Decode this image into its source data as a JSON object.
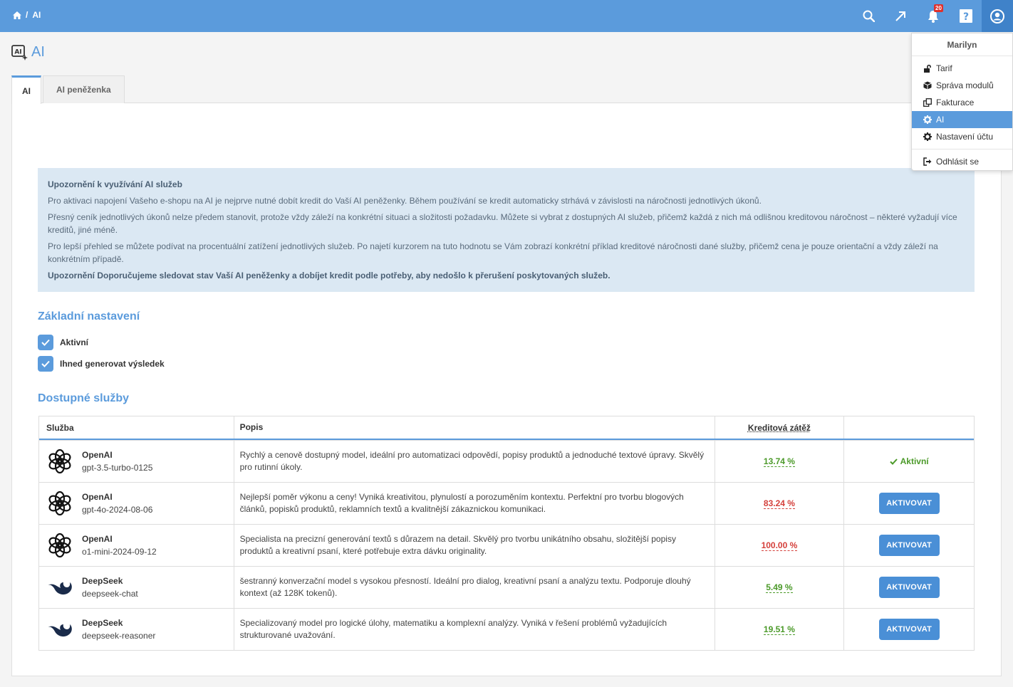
{
  "breadcrumb": {
    "current": "AI"
  },
  "topbar": {
    "notification_count": "20"
  },
  "page": {
    "title": "AI"
  },
  "tabs": [
    {
      "label": "AI"
    },
    {
      "label": "AI peněženka"
    }
  ],
  "alert": {
    "heading": "Upozornění k využívání AI služeb",
    "p1": "Pro aktivaci napojení Vašeho e-shopu na AI je nejprve nutné dobít kredit do Vaší AI peněženky. Během používání se kredit automaticky strhává v závislosti na náročnosti jednotlivých úkonů.",
    "p2": "Přesný ceník jednotlivých úkonů nelze předem stanovit, protože vždy záleží na konkrétní situaci a složitosti požadavku. Můžete si vybrat z dostupných AI služeb, přičemž každá z nich má odlišnou kreditovou náročnost – některé vyžadují více kreditů, jiné méně.",
    "p3": "Pro lepší přehled se můžete podívat na procentuální zatížení jednotlivých služeb. Po najetí kurzorem na tuto hodnotu se Vám zobrazí konkrétní příklad kreditové náročnosti dané služby, přičemž cena je pouze orientační a vždy záleží na konkrétním případě.",
    "warning": "Upozornění Doporučujeme sledovat stav Vaší AI peněženky a dobíjet kredit podle potřeby, aby nedošlo k přerušení poskytovaných služeb."
  },
  "settings": {
    "title": "Základní nastavení",
    "active_label": "Aktivní",
    "generate_label": "Ihned generovat výsledek"
  },
  "services": {
    "title": "Dostupné služby",
    "columns": {
      "service": "Služba",
      "desc": "Popis",
      "load": "Kreditová zátěž"
    },
    "rows": [
      {
        "provider": "OpenAI",
        "model": "gpt-3.5-turbo-0125",
        "desc": "Rychlý a cenově dostupný model, ideální pro automatizaci odpovědí, popisy produktů a jednoduché textové úpravy. Skvělý pro rutinní úkoly.",
        "load": "13.74 %",
        "status": "Aktivní"
      },
      {
        "provider": "OpenAI",
        "model": "gpt-4o-2024-08-06",
        "desc": "Nejlepší poměr výkonu a ceny! Vyniká kreativitou, plynulostí a porozuměním kontextu. Perfektní pro tvorbu blogových článků, popisků produktů, reklamních textů a kvalitnější zákaznickou komunikaci.",
        "load": "83.24 %",
        "button": "AKTIVOVAT"
      },
      {
        "provider": "OpenAI",
        "model": "o1-mini-2024-09-12",
        "desc": "Specialista na precizní generování textů s důrazem na detail. Skvělý pro tvorbu unikátního obsahu, složitější popisy produktů a kreativní psaní, které potřebuje extra dávku originality.",
        "load": "100.00 %",
        "button": "AKTIVOVAT"
      },
      {
        "provider": "DeepSeek",
        "model": "deepseek-chat",
        "desc": "šestranný konverzační model s vysokou přesností. Ideální pro dialog, kreativní psaní a analýzu textu. Podporuje dlouhý kontext (až 128K tokenů).",
        "load": "5.49 %",
        "button": "AKTIVOVAT"
      },
      {
        "provider": "DeepSeek",
        "model": "deepseek-reasoner",
        "desc": "Specializovaný model pro logické úlohy, matematiku a komplexní analýzy. Vyniká v řešení problémů vyžadujících strukturované uvažování.",
        "load": "19.51 %",
        "button": "AKTIVOVAT"
      }
    ]
  },
  "user_menu": {
    "user": "Marilyn",
    "items": [
      {
        "label": "Tarif",
        "icon": "unlock-icon"
      },
      {
        "label": "Správa modulů",
        "icon": "cube-icon"
      },
      {
        "label": "Fakturace",
        "icon": "copy-icon"
      },
      {
        "label": "AI",
        "icon": "gear-icon"
      },
      {
        "label": "Nastavení účtu",
        "icon": "gear-icon"
      },
      {
        "label": "Odhlásit se",
        "icon": "sign-out-icon"
      }
    ]
  }
}
